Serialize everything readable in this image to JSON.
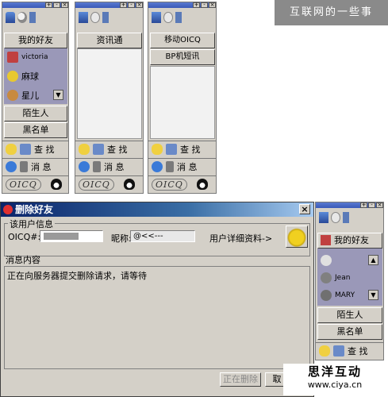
{
  "watermark_top": "互联网的一些事",
  "watermark_bottom": {
    "title": "思洋互动",
    "url": "www.ciya.cn"
  },
  "panel1": {
    "my_friends": "我的好友",
    "friends": [
      "victoria",
      "麻球",
      "星儿"
    ],
    "strangers": "陌生人",
    "blacklist": "黑名单",
    "find_label": "查 找",
    "message_label": "消 息",
    "logo": "OICQ"
  },
  "panel2": {
    "info_tab": "资讯通",
    "find_label": "查 找",
    "message_label": "消 息",
    "logo": "OICQ"
  },
  "panel3": {
    "tabs": [
      "移动OICQ",
      "BP机短讯"
    ],
    "find_label": "查 找",
    "message_label": "消 息",
    "logo": "OICQ"
  },
  "dialog": {
    "title": "删除好友",
    "close_glyph": "×",
    "group_label": "该用户信息",
    "oicq_label": "OICQ#:",
    "nickname_label": "昵称:",
    "nickname_value": "@<<---",
    "details_label": "用户详细资料->",
    "message_section": "消息内容",
    "message_text": "正在向服务器提交删除请求，请等待",
    "deleting_button": "正在删除",
    "cancel_button": "取"
  },
  "panel4": {
    "my_friends": "我的好友",
    "friends": [
      "",
      "Jean",
      "MARY"
    ],
    "strangers": "陌生人",
    "blacklist": "黑名单",
    "find_label": "查 找"
  }
}
